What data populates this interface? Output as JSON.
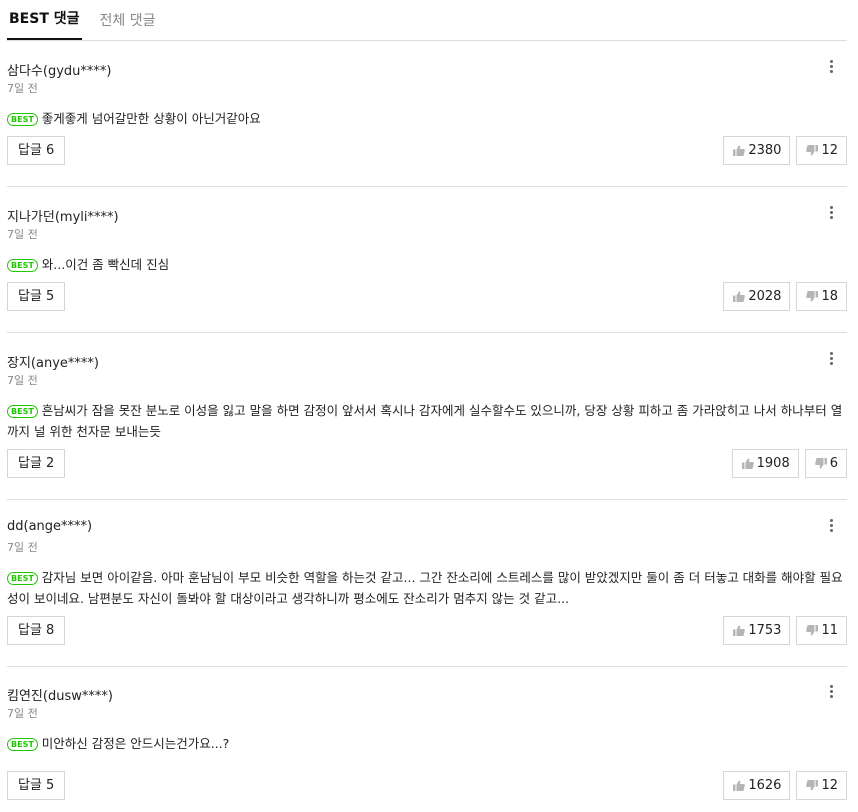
{
  "tabs": [
    {
      "label": "BEST 댓글",
      "active": true
    },
    {
      "label": "전체 댓글",
      "active": false
    }
  ],
  "badge_label": "BEST",
  "comments": [
    {
      "author": "삼다수(gydu****)",
      "time": "7일 전",
      "text": "좋게좋게 넘어갈만한 상황이 아닌거같아요",
      "replies": "답글 6",
      "likes": "2380",
      "dislikes": "12"
    },
    {
      "author": "지나가던(myli****)",
      "time": "7일 전",
      "text": "와...이건 좀 빡신데 진심",
      "replies": "답글 5",
      "likes": "2028",
      "dislikes": "18"
    },
    {
      "author": "장지(anye****)",
      "time": "7일 전",
      "text": "흔남씨가 잠을 못잔 분노로 이성을 잃고 말을 하면 감정이 앞서서 혹시나 감자에게 실수할수도 있으니까, 당장 상황 피하고 좀 가라앉히고 나서 하나부터 열까지 널 위한 천자문 보내는듯",
      "replies": "답글 2",
      "likes": "1908",
      "dislikes": "6"
    },
    {
      "author": "dd(ange****)",
      "time": "7일 전",
      "text": "감자님 보면 아이같음. 아마 훈남님이 부모 비슷한 역할을 하는것 같고... 그간 잔소리에 스트레스를 많이 받았겠지만 둘이 좀 더 터놓고 대화를 해야할 필요성이 보이네요. 남편분도 자신이 돌봐야 할 대상이라고 생각하니까 평소에도 잔소리가 멈추지 않는 것 같고...",
      "replies": "답글 8",
      "likes": "1753",
      "dislikes": "11"
    },
    {
      "author": "킴연진(dusw****)",
      "time": "7일 전",
      "text": "미안하신 감정은 안드시는건가요...?",
      "replies": "답글 5",
      "likes": "1626",
      "dislikes": "12"
    }
  ],
  "colors": {
    "best_badge": "#1ec800",
    "divider": "#dddddd",
    "meta_text": "#888888"
  },
  "icons": {
    "more": "more-vertical-icon",
    "like": "thumbs-up-icon",
    "dislike": "thumbs-down-icon"
  }
}
